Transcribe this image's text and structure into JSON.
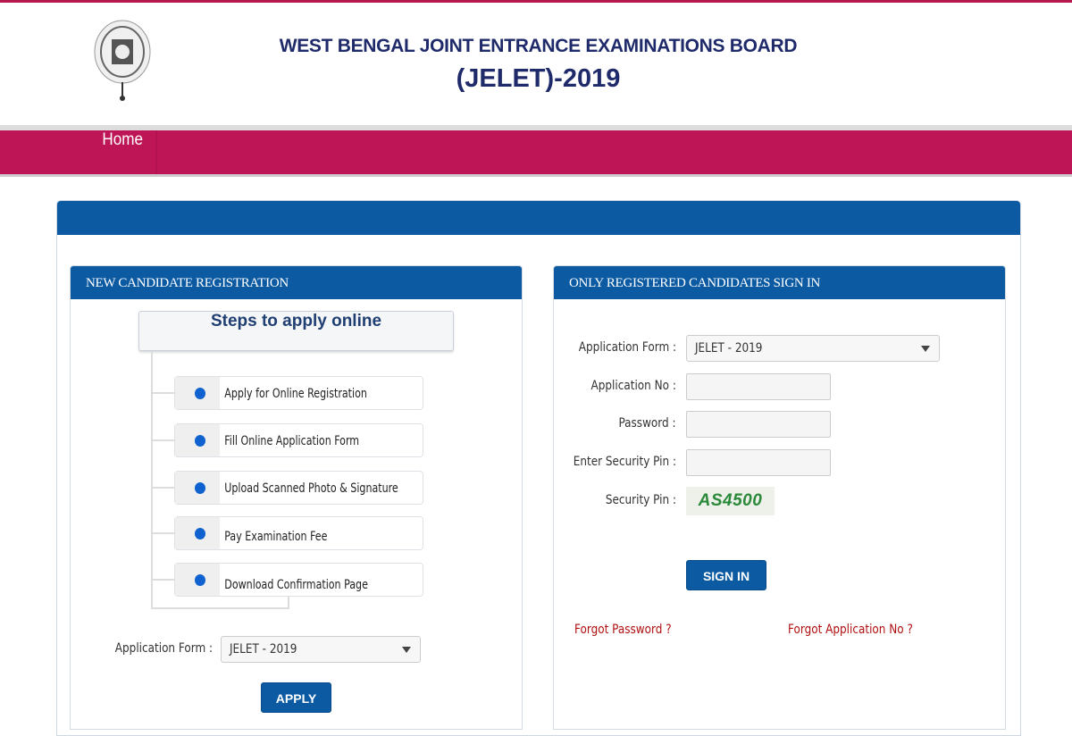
{
  "header": {
    "title": "WEST BENGAL JOINT ENTRANCE EXAMINATIONS BOARD",
    "subtitle": "(JELET)-2019",
    "logo_text": "WEST BENGAL JOINT ENTRANCE EXAMINATIONS BOARD"
  },
  "nav": {
    "items": [
      {
        "label": "Home"
      }
    ]
  },
  "colors": {
    "nav": "#be1556",
    "panel_header": "#0b5aa2",
    "step_bullet": "#0f62cf",
    "link": "#b01010"
  },
  "registration": {
    "heading": "NEW CANDIDATE REGISTRATION",
    "steps_title": "Steps to apply online",
    "steps": [
      {
        "label": "Apply for Online Registration"
      },
      {
        "label": "Fill Online Application Form"
      },
      {
        "label": "Upload Scanned Photo & Signature"
      },
      {
        "label": "Pay Examination Fee"
      },
      {
        "label": "Download Confirmation Page"
      }
    ],
    "form_label": "Application Form :",
    "form_value": "JELET - 2019",
    "apply_label": "APPLY"
  },
  "signin": {
    "heading": "ONLY REGISTERED CANDIDATES SIGN IN",
    "form_label": "Application Form :",
    "form_value": "JELET - 2019",
    "app_no_label": "Application No :",
    "app_no_value": "",
    "password_label": "Password :",
    "password_value": "",
    "pin_label": "Enter Security Pin :",
    "pin_value": "",
    "captcha_label": "Security Pin :",
    "captcha_value": "AS4500",
    "signin_label": "SIGN IN",
    "forgot_password": "Forgot Password ?",
    "forgot_app_no": "Forgot Application No ?"
  }
}
